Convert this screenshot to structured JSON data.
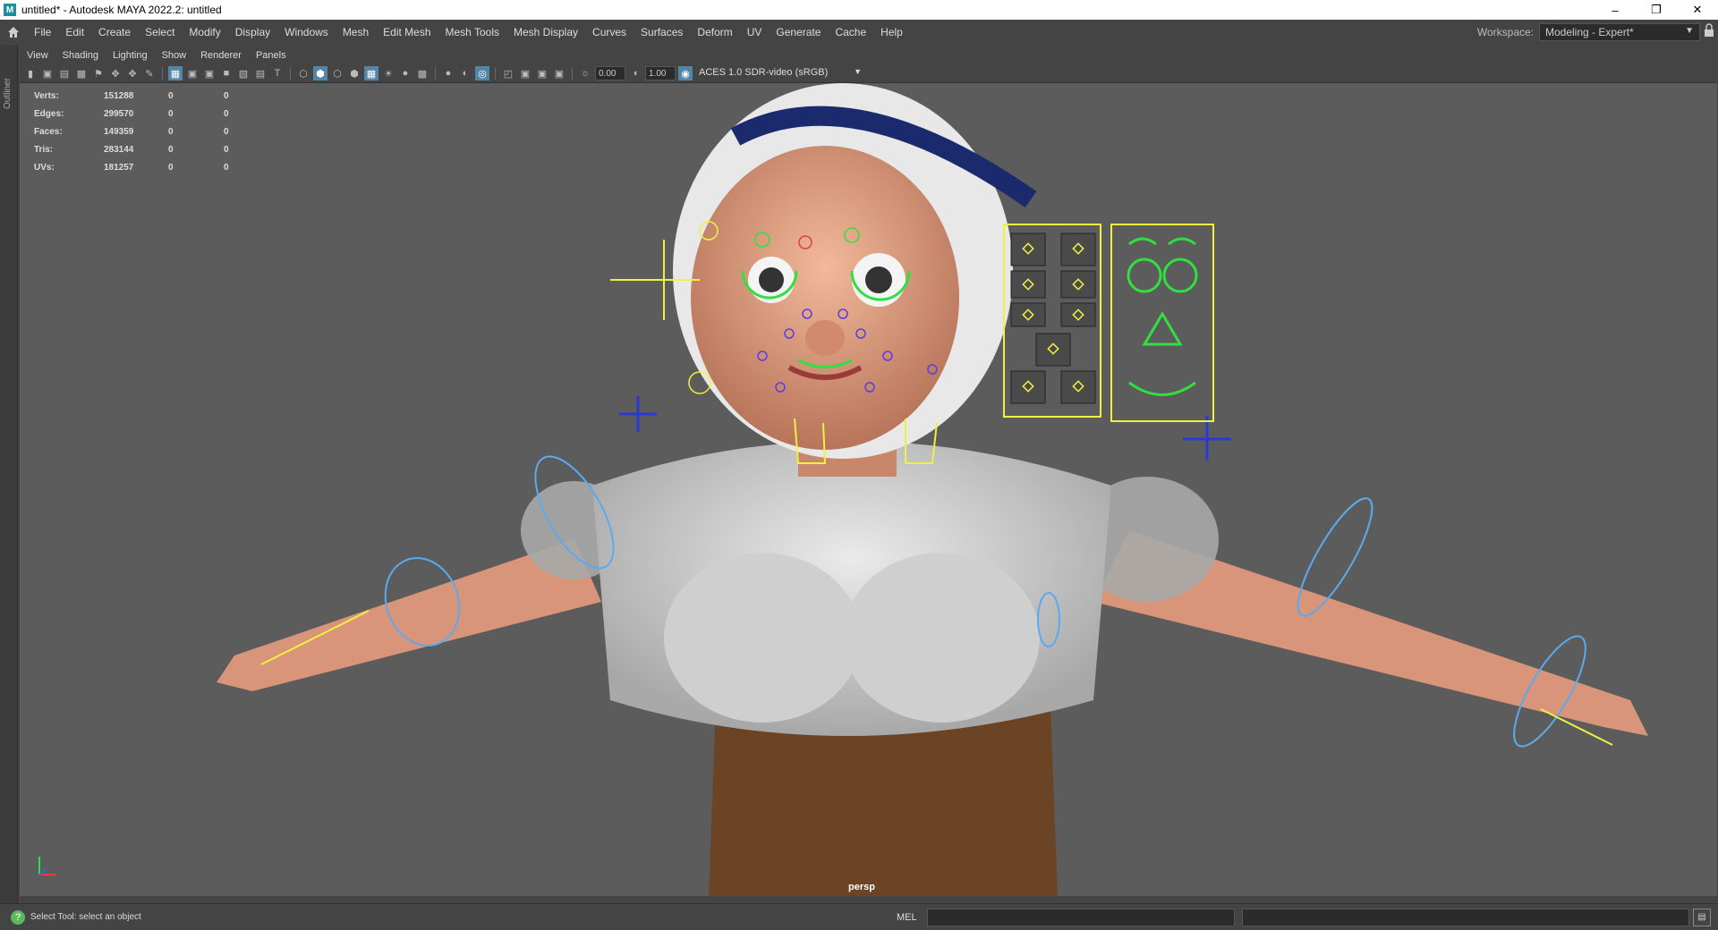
{
  "window": {
    "title": "untitled* - Autodesk MAYA 2022.2: untitled",
    "app_icon": "M",
    "controls": [
      "minimize-icon",
      "restore-icon",
      "close-icon"
    ]
  },
  "menu": {
    "items": [
      "File",
      "Edit",
      "Create",
      "Select",
      "Modify",
      "Display",
      "Windows",
      "Mesh",
      "Edit Mesh",
      "Mesh Tools",
      "Mesh Display",
      "Curves",
      "Surfaces",
      "Deform",
      "UV",
      "Generate",
      "Cache",
      "Help"
    ],
    "workspace_label": "Workspace:",
    "workspace_value": "Modeling - Expert*"
  },
  "left_strip": {
    "outliner_label": "Outliner"
  },
  "panel_menu": {
    "items": [
      "View",
      "Shading",
      "Lighting",
      "Show",
      "Renderer",
      "Panels"
    ]
  },
  "toolbar": {
    "exposure": "0.00",
    "gamma": "1.00",
    "color_space": "ACES 1.0 SDR-video (sRGB)"
  },
  "hud": {
    "rows": [
      {
        "label": "Verts:",
        "v1": "151288",
        "v2": "0",
        "v3": "0"
      },
      {
        "label": "Edges:",
        "v1": "299570",
        "v2": "0",
        "v3": "0"
      },
      {
        "label": "Faces:",
        "v1": "149359",
        "v2": "0",
        "v3": "0"
      },
      {
        "label": "Tris:",
        "v1": "283144",
        "v2": "0",
        "v3": "0"
      },
      {
        "label": "UVs:",
        "v1": "181257",
        "v2": "0",
        "v3": "0"
      }
    ]
  },
  "viewport": {
    "camera": "persp"
  },
  "status": {
    "help_text": "Select Tool: select an object",
    "cmd_language": "MEL"
  },
  "colors": {
    "viewport_bg": "#5c5c5c",
    "ui_bg": "#444444",
    "active_icon": "#5285a6",
    "rig_yellow": "#f0f040",
    "rig_blue": "#5aaaf0",
    "rig_green": "#30e040"
  }
}
